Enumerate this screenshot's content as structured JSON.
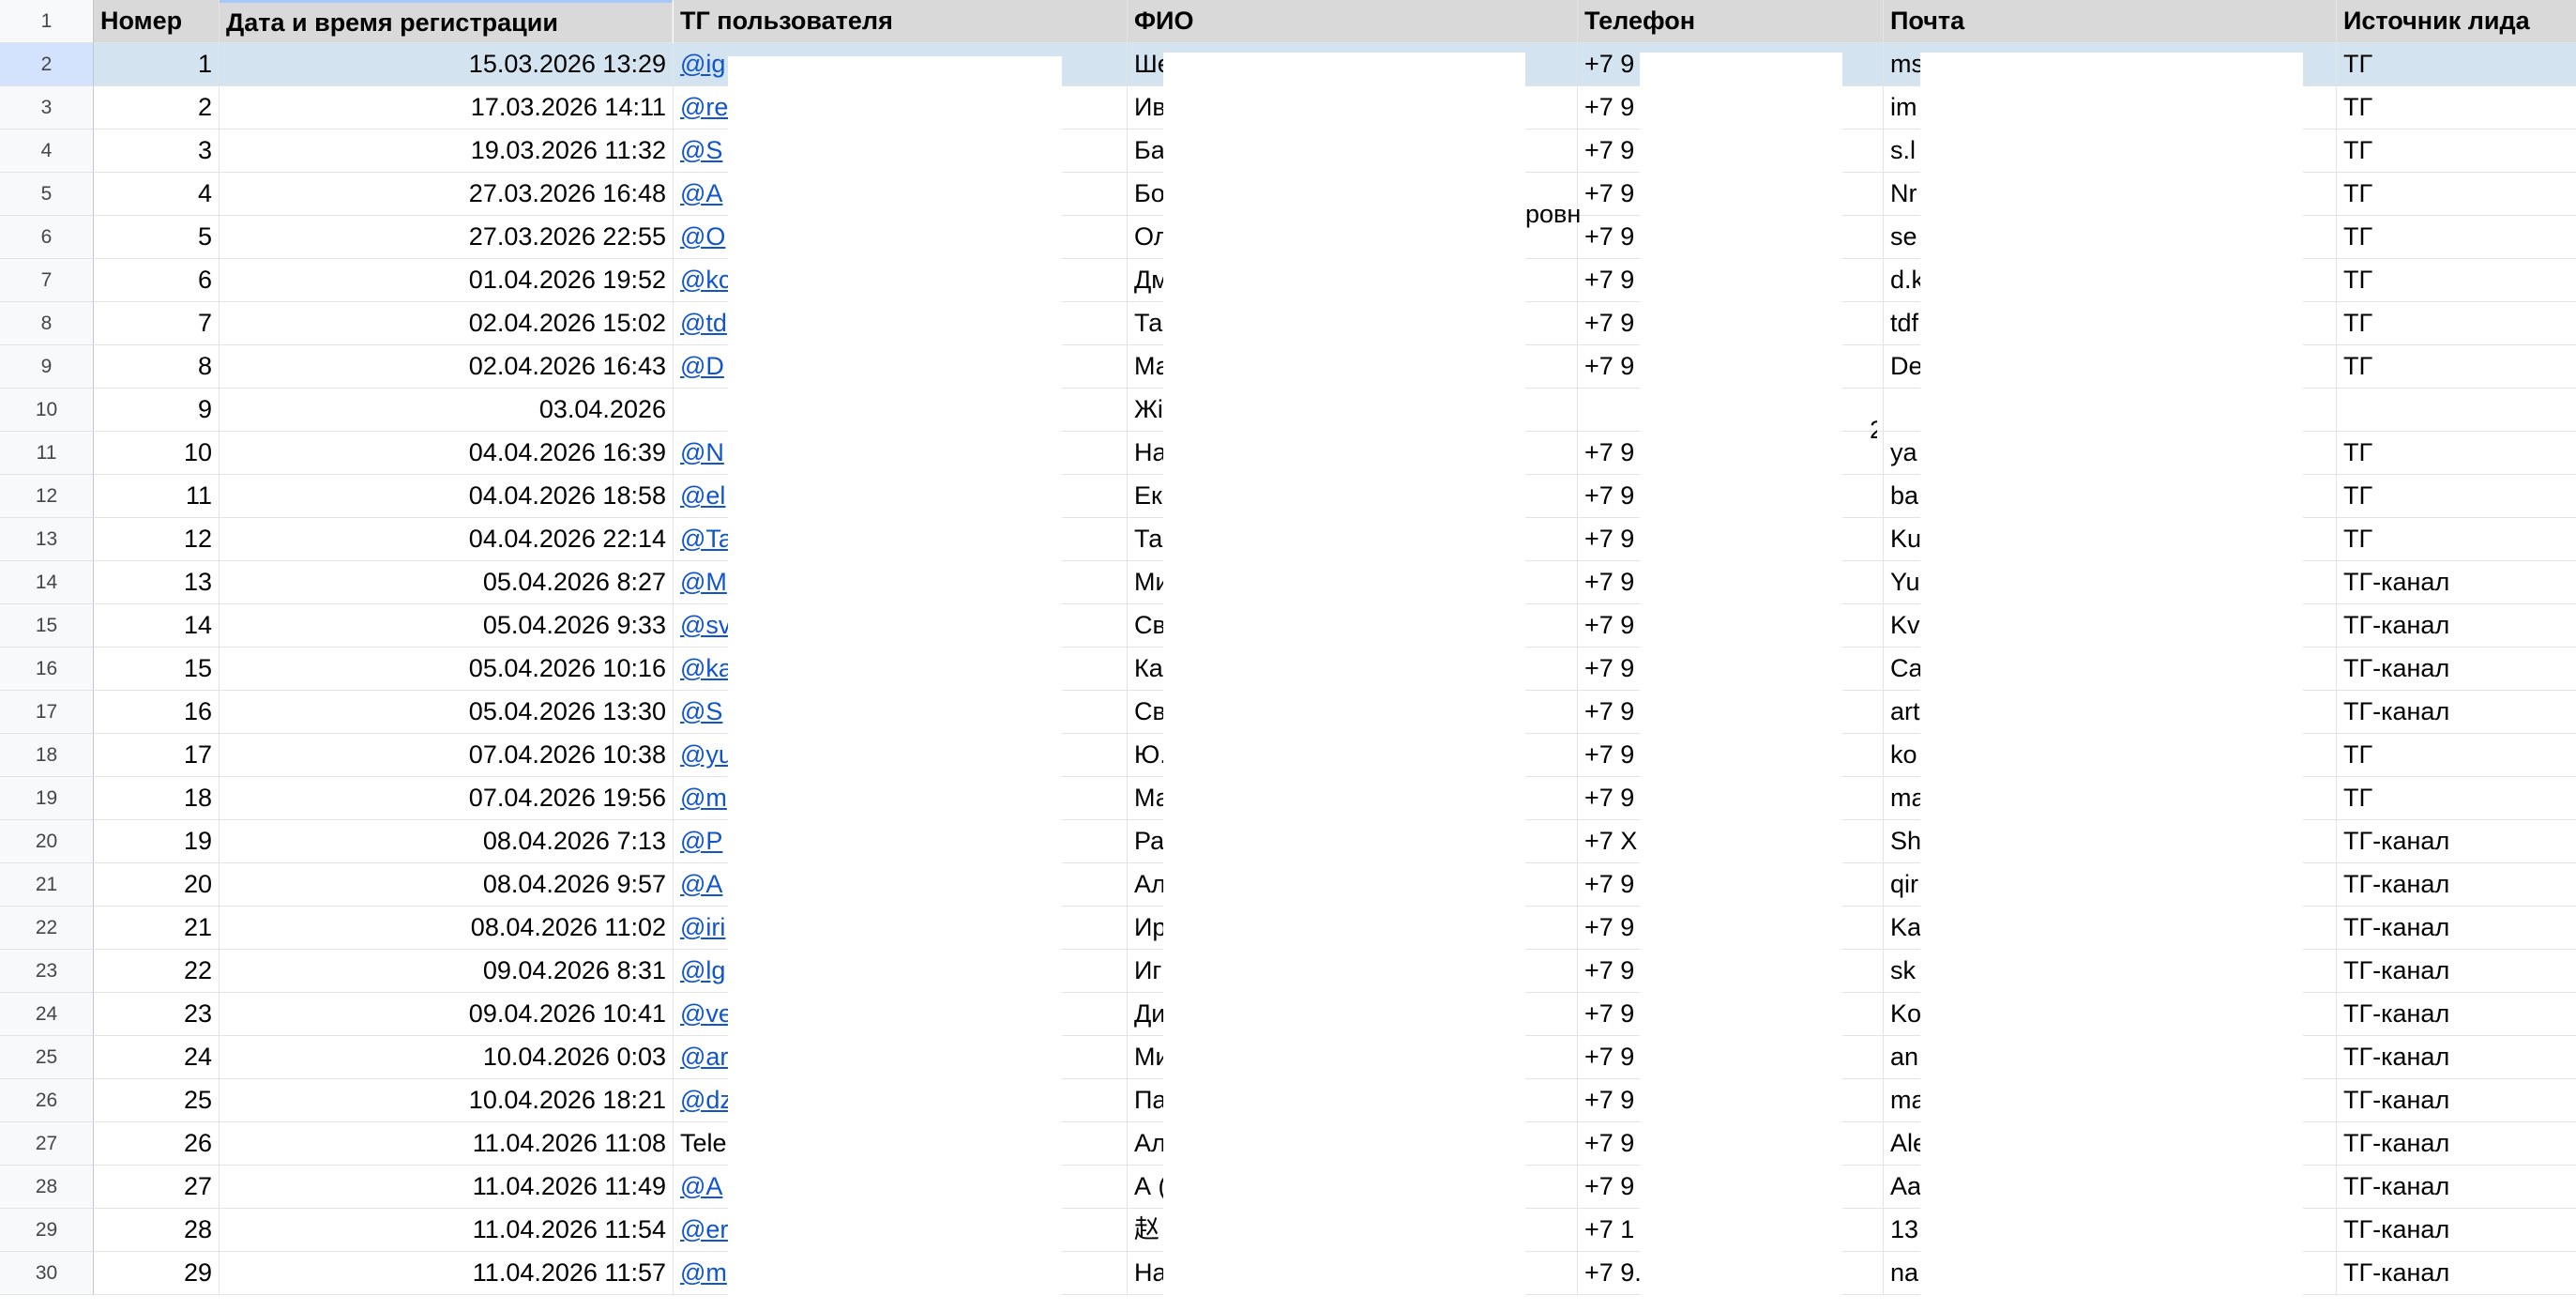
{
  "header": {
    "row_number": "1",
    "columns": [
      "Номер",
      "Дата и время регистрации",
      "ТГ пользователя",
      "ФИО",
      "Телефон",
      "Почта",
      "Источник лида"
    ]
  },
  "rows": [
    {
      "row": "2",
      "num": "1",
      "datetime": "15.03.2026 13:29",
      "tg": "@ig",
      "fio": "Ше",
      "phone": "+7 9",
      "email": "ms",
      "source": "ТГ"
    },
    {
      "row": "3",
      "num": "2",
      "datetime": "17.03.2026 14:11",
      "tg": "@re",
      "fio": "Ив",
      "phone": "+7 9",
      "email": "im",
      "source": "ТГ"
    },
    {
      "row": "4",
      "num": "3",
      "datetime": "19.03.2026 11:32",
      "tg": "@S",
      "fio": "Ба",
      "phone": "+7 9",
      "email": "s.l",
      "source": "ТГ"
    },
    {
      "row": "5",
      "num": "4",
      "datetime": "27.03.2026 16:48",
      "tg": "@A",
      "fio": "Бо",
      "phone": "+7 9",
      "email": "Nr",
      "source": "ТГ"
    },
    {
      "row": "6",
      "num": "5",
      "datetime": "27.03.2026 22:55",
      "tg": "@O",
      "fio": "Ол",
      "phone": "+7 9",
      "email": "se",
      "source": "ТГ"
    },
    {
      "row": "7",
      "num": "6",
      "datetime": "01.04.2026 19:52",
      "tg": "@kc",
      "fio": "Дм",
      "phone": "+7 9",
      "email": "d.k",
      "source": "ТГ"
    },
    {
      "row": "8",
      "num": "7",
      "datetime": "02.04.2026 15:02",
      "tg": "@td",
      "fio": "Та",
      "phone": "+7 9",
      "email": "tdf",
      "source": "ТГ"
    },
    {
      "row": "9",
      "num": "8",
      "datetime": "02.04.2026 16:43",
      "tg": "@D",
      "fio": "Ма",
      "phone": "+7 9",
      "email": "De",
      "source": "ТГ"
    },
    {
      "row": "10",
      "num": "9",
      "datetime": "03.04.2026",
      "tg": "",
      "fio": "Жі",
      "phone": "",
      "email": "",
      "source": ""
    },
    {
      "row": "11",
      "num": "10",
      "datetime": "04.04.2026 16:39",
      "tg": "@N",
      "fio": "На",
      "phone": "+7 9",
      "email": "ya",
      "source": "ТГ"
    },
    {
      "row": "12",
      "num": "11",
      "datetime": "04.04.2026 18:58",
      "tg": "@el",
      "fio": "Ек",
      "phone": "+7 9",
      "email": "ba",
      "source": "ТГ"
    },
    {
      "row": "13",
      "num": "12",
      "datetime": "04.04.2026 22:14",
      "tg": "@Ta",
      "fio": "Та",
      "phone": "+7 9",
      "email": "Ku",
      "source": "ТГ"
    },
    {
      "row": "14",
      "num": "13",
      "datetime": "05.04.2026 8:27",
      "tg": "@M",
      "fio": "Ми",
      "phone": "+7 9",
      "email": "Yu",
      "source": "ТГ-канал"
    },
    {
      "row": "15",
      "num": "14",
      "datetime": "05.04.2026 9:33",
      "tg": "@sv",
      "fio": "Св",
      "phone": "+7 9",
      "email": "Kv",
      "source": "ТГ-канал"
    },
    {
      "row": "16",
      "num": "15",
      "datetime": "05.04.2026 10:16",
      "tg": "@ka",
      "fio": "Ка",
      "phone": "+7 9",
      "email": "Ca",
      "source": "ТГ-канал"
    },
    {
      "row": "17",
      "num": "16",
      "datetime": "05.04.2026 13:30",
      "tg": "@S",
      "fio": "Св",
      "phone": "+7 9",
      "email": "art",
      "source": "ТГ-канал"
    },
    {
      "row": "18",
      "num": "17",
      "datetime": "07.04.2026 10:38",
      "tg": "@yu",
      "fio": "Ю.",
      "phone": "+7 9",
      "email": "ko",
      "source": "ТГ"
    },
    {
      "row": "19",
      "num": "18",
      "datetime": "07.04.2026 19:56",
      "tg": "@m",
      "fio": "Ма",
      "phone": "+7 9",
      "email": "ma",
      "source": "ТГ"
    },
    {
      "row": "20",
      "num": "19",
      "datetime": "08.04.2026 7:13",
      "tg": "@P",
      "fio": "Ра",
      "phone": "+7 X",
      "email": "Sh",
      "source": "ТГ-канал"
    },
    {
      "row": "21",
      "num": "20",
      "datetime": "08.04.2026 9:57",
      "tg": "@A",
      "fio": "Ал",
      "phone": "+7 9",
      "email": "qir",
      "source": "ТГ-канал"
    },
    {
      "row": "22",
      "num": "21",
      "datetime": "08.04.2026 11:02",
      "tg": "@iri",
      "fio": "Ир",
      "phone": "+7 9",
      "email": "Ka",
      "source": "ТГ-канал"
    },
    {
      "row": "23",
      "num": "22",
      "datetime": "09.04.2026 8:31",
      "tg": "@lg",
      "fio": "Иг",
      "phone": "+7 9",
      "email": "sk",
      "source": "ТГ-канал"
    },
    {
      "row": "24",
      "num": "23",
      "datetime": "09.04.2026 10:41",
      "tg": "@ve",
      "fio": "Ди",
      "phone": "+7 9",
      "email": "Ko",
      "source": "ТГ-канал"
    },
    {
      "row": "25",
      "num": "24",
      "datetime": "10.04.2026 0:03",
      "tg": "@ar",
      "fio": "Ми",
      "phone": "+7 9",
      "email": "an",
      "source": "ТГ-канал"
    },
    {
      "row": "26",
      "num": "25",
      "datetime": "10.04.2026 18:21",
      "tg": "@dz",
      "fio": "Па",
      "phone": "+7 9",
      "email": "ma",
      "source": "ТГ-канал"
    },
    {
      "row": "27",
      "num": "26",
      "datetime": "11.04.2026 11:08",
      "tg": "Tele",
      "fio": "Ал",
      "phone": "+7 9",
      "email": "Ale",
      "source": "ТГ-канал"
    },
    {
      "row": "28",
      "num": "27",
      "datetime": "11.04.2026 11:49",
      "tg": "@A",
      "fio": "А (",
      "phone": "+7 9",
      "email": "Aa",
      "source": "ТГ-канал"
    },
    {
      "row": "29",
      "num": "28",
      "datetime": "11.04.2026 11:54",
      "tg": "@er",
      "fio": "赵",
      "phone": "+7 1",
      "email": "13",
      "source": "ТГ-канал"
    },
    {
      "row": "30",
      "num": "29",
      "datetime": "11.04.2026 11:57",
      "tg": "@m",
      "fio": "На",
      "phone": "+7 9.",
      "email": "na",
      "source": "ТГ-канал"
    }
  ],
  "fragments": {
    "row5_fio_overflow": "ровн",
    "row10_overflow_mark": "2"
  },
  "colors": {
    "header_fill": "#d9d9d9",
    "selected_row_fill": "#d3e3f0",
    "link": "#1155cc",
    "grid": "#e2e3e3"
  }
}
